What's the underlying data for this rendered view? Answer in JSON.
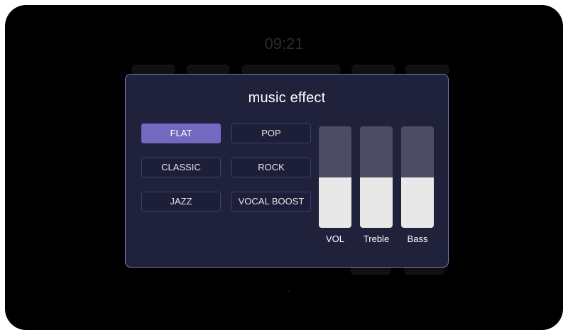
{
  "background": {
    "clock": "09:21"
  },
  "dialog": {
    "title": "music effect",
    "presets": [
      {
        "label": "FLAT",
        "selected": true
      },
      {
        "label": "POP",
        "selected": false
      },
      {
        "label": "CLASSIC",
        "selected": false
      },
      {
        "label": "ROCK",
        "selected": false
      },
      {
        "label": "JAZZ",
        "selected": false
      },
      {
        "label": "VOCAL BOOST",
        "selected": false
      }
    ],
    "sliders": [
      {
        "label": "VOL",
        "level": 0.5
      },
      {
        "label": "Treble",
        "level": 0.5
      },
      {
        "label": "Bass",
        "level": 0.5
      }
    ]
  },
  "colors": {
    "accent": "#7369c0",
    "dialog_border": "#7d74c2",
    "dialog_bg": "#20213a",
    "slider_track": "#4c4d63",
    "slider_fill": "#e8e8e8"
  }
}
